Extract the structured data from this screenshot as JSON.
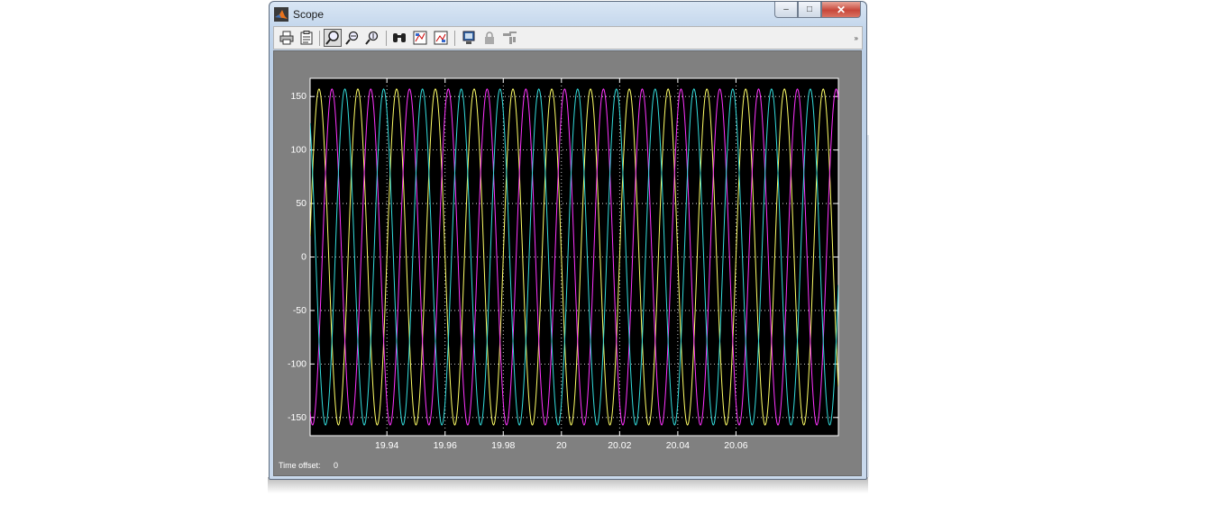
{
  "window": {
    "title": "Scope",
    "buttons": {
      "minimize": "‒",
      "maximize": "□",
      "close": "✕"
    }
  },
  "toolbar": {
    "items": [
      {
        "name": "print-icon"
      },
      {
        "name": "parameters-icon"
      },
      {
        "name": "zoom-icon",
        "active": true
      },
      {
        "name": "zoom-x-icon"
      },
      {
        "name": "zoom-y-icon"
      },
      {
        "name": "autoscale-icon"
      },
      {
        "name": "save-axes-icon"
      },
      {
        "name": "restore-axes-icon"
      },
      {
        "name": "floating-scope-icon"
      },
      {
        "name": "lock-axes-icon"
      },
      {
        "name": "signal-selector-icon"
      }
    ],
    "overflow": "»"
  },
  "footer": {
    "time_offset_label": "Time offset:",
    "time_offset_value": "0"
  },
  "colors": {
    "plot_bg": "#000000",
    "figure_bg": "#808080",
    "grid": "#ffffff",
    "series_yellow": "#ffff66",
    "series_magenta": "#ff33ff",
    "series_cyan": "#33dddd"
  },
  "chart_data": {
    "type": "line",
    "title": "",
    "xlabel": "",
    "ylabel": "",
    "xlim": [
      19.9668,
      20.0576
    ],
    "ylim": [
      -167,
      167
    ],
    "xticks": [
      19.98,
      19.99,
      20.0,
      20.01,
      20.02,
      20.03,
      20.04
    ],
    "xtick_labels": [
      "19.94",
      "19.96",
      "19.98",
      "20",
      "20.02",
      "20.04",
      "20.06"
    ],
    "yticks": [
      150,
      100,
      50,
      0,
      -50,
      -100,
      -150
    ],
    "ytick_labels": [
      "150",
      "100",
      "50",
      "0",
      "-50",
      "-100",
      "-150"
    ],
    "grid": true,
    "series": [
      {
        "color": "#ffff66",
        "amplitude": 157,
        "frequency_hz": 150,
        "phase_deg": 0
      },
      {
        "color": "#ff33ff",
        "amplitude": 157,
        "frequency_hz": 150,
        "phase_deg": 240
      },
      {
        "color": "#33dddd",
        "amplitude": 157,
        "frequency_hz": 150,
        "phase_deg": 120
      }
    ]
  }
}
